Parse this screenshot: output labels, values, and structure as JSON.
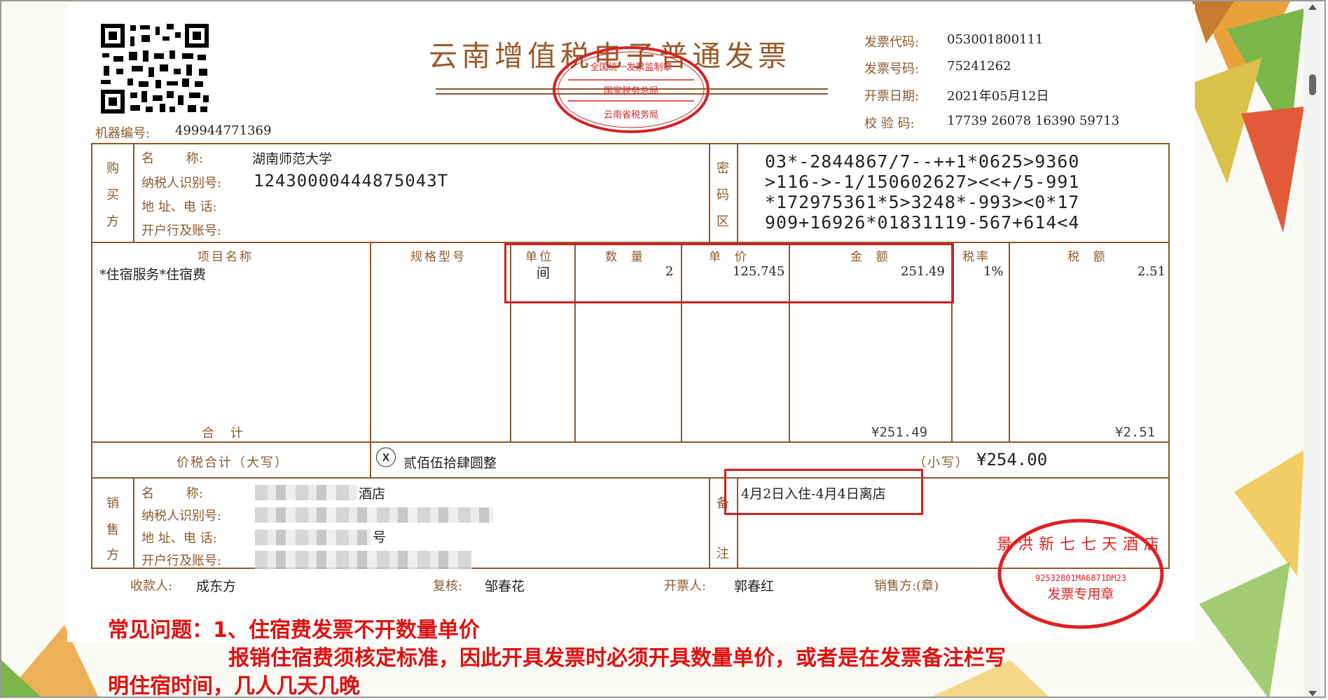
{
  "invoice": {
    "title": "云南增值税电子普通发票",
    "code_label": "发票代码:",
    "code_value": "053001800111",
    "number_label": "发票号码:",
    "number_value": "75241262",
    "date_label": "开票日期:",
    "date_value": "2021年05月12日",
    "check_label": "校 验 码:",
    "check_value": "17739 26078 16390 59713",
    "machine_label": "机器编号:",
    "machine_value": "499944771369"
  },
  "stamp_top": {
    "line1": "全国统一发票监制章",
    "line2": "国家税务总局",
    "line3": "云南省税务局"
  },
  "buyer": {
    "side_label": [
      "购",
      "买",
      "方"
    ],
    "name_label": "名        称:",
    "name_value": "湖南师范大学",
    "taxid_label": "纳税人识别号:",
    "taxid_value": "12430000444875043T",
    "addr_label": "地 址、电 话:",
    "bank_label": "开户行及账号:"
  },
  "cipher": {
    "side_label": [
      "密",
      "码",
      "区"
    ],
    "lines": [
      "03*-2844867/7--++1*0625>9360",
      ">116->-1/150602627><<+/5-991",
      "*172975361*5>3248*-993><0*17",
      "909+16926*01831119-567+614<4"
    ]
  },
  "items": {
    "headers": {
      "name": "项目名称",
      "spec": "规格型号",
      "unit": "单位",
      "qty": "数  量",
      "price": "单  价",
      "amount": "金  额",
      "rate": "税率",
      "tax": "税  额"
    },
    "row": {
      "name": "*住宿服务*住宿费",
      "unit": "间",
      "qty": "2",
      "price": "125.745",
      "amount": "251.49",
      "rate": "1%",
      "tax": "2.51"
    },
    "total_label": "合    计",
    "total_amount": "¥251.49",
    "total_tax": "¥2.51"
  },
  "total": {
    "label": "价税合计（大写）",
    "circle_icon": "ⓧ",
    "words": "贰佰伍拾肆圆整",
    "small_label": "（小写）",
    "small_value": "¥254.00"
  },
  "seller": {
    "side_label": [
      "销",
      "售",
      "方"
    ],
    "name_label": "名        称:",
    "name_value": "酒店",
    "taxid_label": "纳税人识别号:",
    "addr_label": "地 址、电 话:",
    "addr_value": "号",
    "bank_label": "开户行及账号:"
  },
  "remarks": {
    "side_label": [
      "备",
      "注"
    ],
    "text": "4月2日入住-4月4日离店"
  },
  "stamp_seller": {
    "name": "景洪新七七天酒店",
    "code": "92532801MA6871DM23",
    "title": "发票专用章"
  },
  "footer": {
    "payee_label": "收款人:",
    "payee_value": "成东方",
    "review_label": "复核:",
    "review_value": "邹春花",
    "issuer_label": "开票人:",
    "issuer_value": "郭春红",
    "seller_label": "销售方:(章)"
  },
  "annotation": {
    "line1": "常见问题：1、住宿费发票不开数量单价",
    "line2": "报销住宿费须核定标准，因此开具发票时必须开具数量单价，或者是在发票备注栏写",
    "line3": "明住宿时间，几人几天几晚"
  },
  "colors": {
    "accent_red": "#d12020",
    "invoice_brown": "#8b5a2b"
  }
}
